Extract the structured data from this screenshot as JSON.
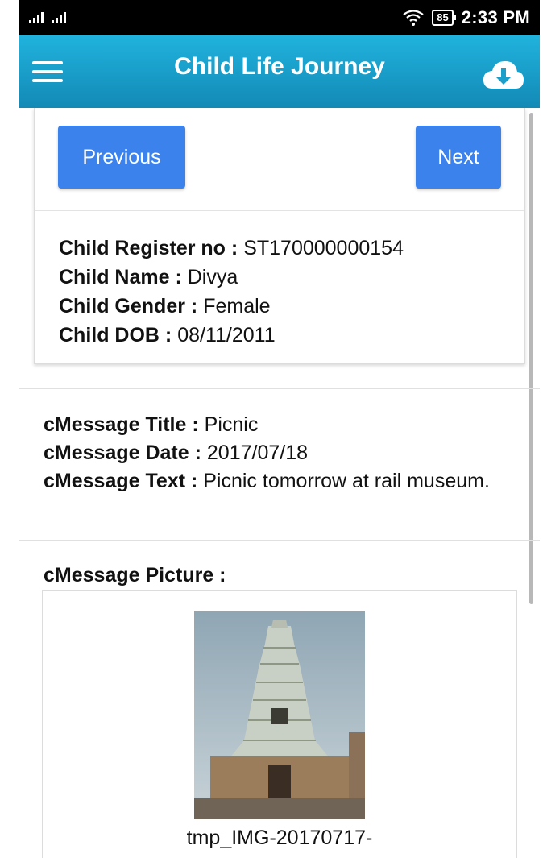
{
  "status_bar": {
    "battery": "85",
    "time": "2:33 PM"
  },
  "toolbar": {
    "title": "Child Life Journey"
  },
  "nav": {
    "previous_label": "Previous",
    "next_label": "Next"
  },
  "child": {
    "register_label": "Child Register no :",
    "register_value": "ST170000000154",
    "name_label": "Child Name :",
    "name_value": "Divya",
    "gender_label": "Child Gender :",
    "gender_value": "Female",
    "dob_label": "Child DOB :",
    "dob_value": "08/11/2011"
  },
  "message": {
    "title_label": "cMessage Title :",
    "title_value": "Picnic",
    "date_label": "cMessage Date :",
    "date_value": "2017/07/18",
    "text_label": "cMessage Text :",
    "text_value": "Picnic tomorrow at rail museum.",
    "picture_label": "cMessage Picture :",
    "picture_filename": "tmp_IMG-20170717-"
  }
}
